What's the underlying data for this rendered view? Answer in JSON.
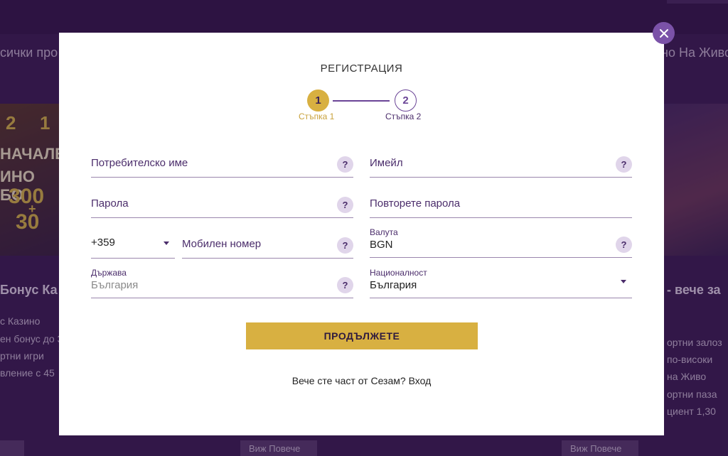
{
  "background": {
    "nav_left": "сички про",
    "nav_right": "но На Живо",
    "banner_left": [
      "2",
      "1",
      "НАЧАЛЕН",
      "ИНО БО",
      "300",
      "+",
      "30"
    ],
    "title_left": "Бонус Ка",
    "title_right": "- вече за",
    "lines_left": [
      "с Казино",
      "ен бонус до 3",
      "ртни игри",
      "вление с 45"
    ],
    "lines_right": [
      "ортни залоз",
      "по-високи",
      "на Живо",
      "ортни паза",
      "циент 1,30"
    ],
    "button_label": "Виж Повече"
  },
  "modal": {
    "title": "РЕГИСТРАЦИЯ",
    "steps": [
      {
        "number": "1",
        "label": "Стъпка 1",
        "active": true
      },
      {
        "number": "2",
        "label": "Стъпка 2",
        "active": false
      }
    ],
    "fields": {
      "username": {
        "placeholder": "Потребителско име",
        "help": "?"
      },
      "email": {
        "placeholder": "Имейл",
        "help": "?"
      },
      "password": {
        "placeholder": "Парола",
        "help": "?"
      },
      "repeat_password": {
        "placeholder": "Повторете парола"
      },
      "phone_code": {
        "value": "+359"
      },
      "mobile": {
        "placeholder": "Мобилен номер",
        "help": "?"
      },
      "currency": {
        "label": "Валута",
        "value": "BGN",
        "help": "?"
      },
      "country": {
        "label": "Държава",
        "value": "България",
        "help": "?"
      },
      "nationality": {
        "label": "Националност",
        "value": "България"
      }
    },
    "submit_label": "ПРОДЪЛЖЕТЕ",
    "login_text": "Вече сте част от Сезам? Вход"
  },
  "colors": {
    "accent_gold": "#d8b041",
    "brand_purple": "#4b2d6b",
    "close_button": "#7b52a8"
  },
  "icons": {
    "close": "close-icon",
    "dropdown": "chevron-down-icon",
    "help": "help-icon"
  }
}
